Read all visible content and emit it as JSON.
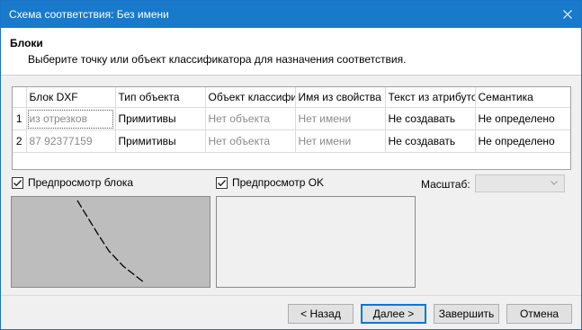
{
  "window": {
    "title": "Схема соответствия: Без имени"
  },
  "header": {
    "title": "Блоки",
    "subtitle": "Выберите точку или объект классификатора для назначения соответствия."
  },
  "grid": {
    "columns": [
      "",
      "Блок DXF",
      "Тип объекта",
      "Объект классифи",
      "Имя из свойства",
      "Текст из атрибуто",
      "Семантика"
    ],
    "rows": [
      [
        "1",
        "из отрезков",
        "Примитивы",
        "Нет объекта",
        "Нет имени",
        "Не создавать",
        "Не определено"
      ],
      [
        "2",
        "87 92377159",
        "Примитивы",
        "Нет объекта",
        "Нет имени",
        "Не создавать",
        "Не определено"
      ]
    ]
  },
  "options": {
    "block_preview": {
      "label": "Предпросмотр блока",
      "checked": true
    },
    "ok_preview": {
      "label": "Предпросмотр OK",
      "checked": true
    },
    "scale_label": "Масштаб:",
    "scale_value": ""
  },
  "buttons": {
    "back": "< Назад",
    "next": "Далее >",
    "finish": "Завершить",
    "cancel": "Отмена"
  },
  "colors": {
    "titlebar": "#1979ca",
    "accent": "#0078d7"
  }
}
